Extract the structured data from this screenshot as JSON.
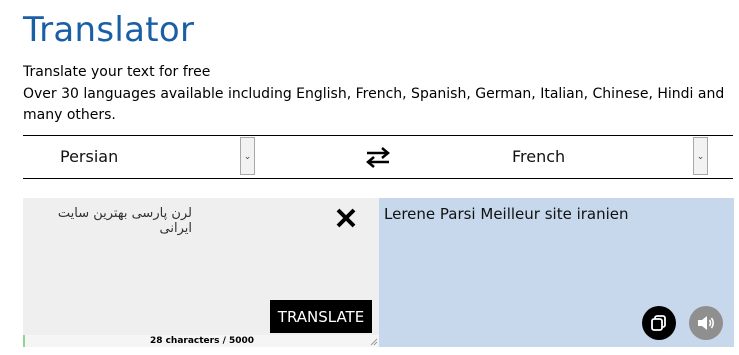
{
  "header": {
    "title": "Translator",
    "subtitle_line1": "Translate your text for free",
    "subtitle_line2": "Over 30 languages available including English, French, Spanish, German, Italian, Chinese, Hindi and many others."
  },
  "languages": {
    "source": "Persian",
    "target": "French",
    "dropdown_icon": "chevron-down-icon",
    "swap_icon": "swap-arrows-icon"
  },
  "source_panel": {
    "text": "لرن پارسی بهترین سایت ایرانی",
    "clear_icon": "close-icon",
    "translate_label": "TRANSLATE",
    "char_count": "28 characters / 5000"
  },
  "target_panel": {
    "text": "Lerene Parsi Meilleur site iranien",
    "copy_icon": "copy-icon",
    "sound_icon": "speaker-icon"
  },
  "colors": {
    "title": "#1a5fa6",
    "source_bg": "#efefef",
    "target_bg": "#c7d8ec",
    "button_bg": "#000000",
    "sound_btn_bg": "#8f8f8f"
  }
}
